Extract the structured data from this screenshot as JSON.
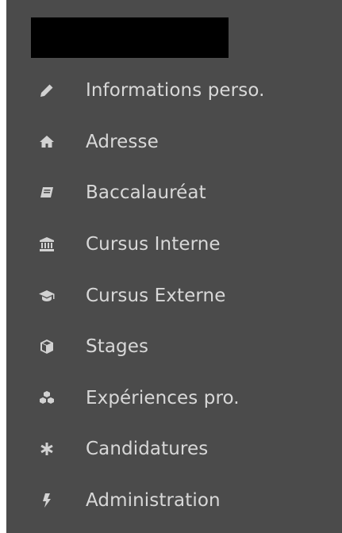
{
  "menu": {
    "items": [
      {
        "label": "Informations perso.",
        "icon": "pencil-icon"
      },
      {
        "label": "Adresse",
        "icon": "home-icon"
      },
      {
        "label": "Baccalauréat",
        "icon": "book-icon"
      },
      {
        "label": "Cursus Interne",
        "icon": "institution-icon"
      },
      {
        "label": "Cursus Externe",
        "icon": "graduation-cap-icon"
      },
      {
        "label": "Stages",
        "icon": "cube-icon"
      },
      {
        "label": "Expériences pro.",
        "icon": "cubes-icon"
      },
      {
        "label": "Candidatures",
        "icon": "asterisk-icon"
      },
      {
        "label": "Administration",
        "icon": "bolt-icon"
      }
    ]
  },
  "colors": {
    "sidebar_background": "#4b4b4b",
    "text": "#d8d8d8",
    "icon": "#d2d2d2",
    "redaction": "#000000"
  }
}
